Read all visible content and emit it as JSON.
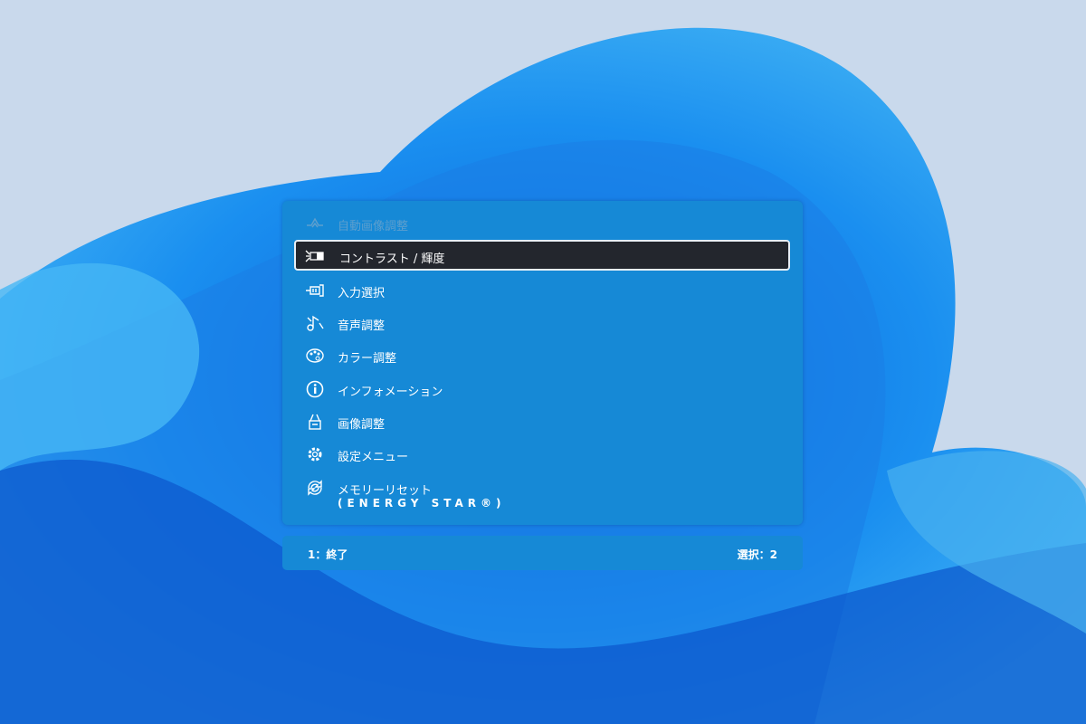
{
  "osd": {
    "menu_items": [
      {
        "label": "自動画像調整",
        "icon": "auto-adjust-icon",
        "state": "disabled"
      },
      {
        "label": "コントラスト / 輝度",
        "icon": "contrast-brightness-icon",
        "state": "selected"
      },
      {
        "label": "入力選択",
        "icon": "input-select-icon"
      },
      {
        "label": "音声調整",
        "icon": "audio-icon"
      },
      {
        "label": "カラー調整",
        "icon": "palette-icon"
      },
      {
        "label": "インフォメーション",
        "icon": "info-icon"
      },
      {
        "label": "画像調整",
        "icon": "image-adjust-icon"
      },
      {
        "label": "設定メニュー",
        "icon": "gear-icon"
      },
      {
        "label": "メモリーリセット",
        "sublabel": "(ENERGY STAR®)",
        "icon": "reset-icon"
      }
    ],
    "footer": {
      "exit": "1：終了",
      "select": "選択：2"
    }
  }
}
